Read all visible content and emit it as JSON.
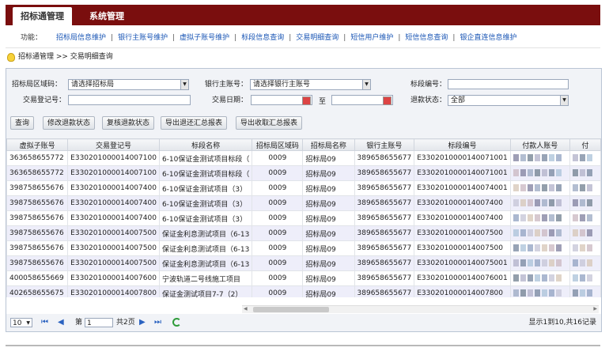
{
  "tabs": [
    "招标通管理",
    "系统管理"
  ],
  "funcbar": {
    "label": "功能：",
    "links": [
      "招标局信息维护",
      "银行主账号维护",
      "虚拟子账号维护",
      "标段信息查询",
      "交易明细查询",
      "短信用户维护",
      "短信信息查询",
      "银企直连信息维护"
    ]
  },
  "breadcrumb": "招标通管理 >> 交易明细查询",
  "form": {
    "area_label": "招标局区域码：",
    "area_value": "请选择招标局",
    "bank_label": "银行主账号：",
    "bank_value": "请选择银行主账号",
    "section_label": "标段编号：",
    "reg_label": "交易登记号：",
    "date_label": "交易日期：",
    "date_to": "至",
    "refund_label": "退款状态：",
    "refund_value": "全部"
  },
  "buttons": [
    "查询",
    "修改退款状态",
    "复核退款状态",
    "导出退还汇总报表",
    "导出收取汇总报表"
  ],
  "table": {
    "headers": [
      "虚拟子账号",
      "交易登记号",
      "标段名称",
      "招标局区域码",
      "招标局名称",
      "银行主账号",
      "标段编号",
      "付款人账号",
      "付"
    ],
    "rows": [
      [
        "363658655772",
        "E330201000014007100",
        "6-10保证金测试项目标段（",
        "0009",
        "招标局09",
        "389658655677",
        "E3302010000140071001"
      ],
      [
        "363658655772",
        "E330201000014007100",
        "6-10保证金测试项目标段（",
        "0009",
        "招标局09",
        "389658655677",
        "E3302010000140071001"
      ],
      [
        "398758655676",
        "E330201000014007400",
        "6-10保证金测试项目（3）",
        "0009",
        "招标局09",
        "389658655677",
        "E3302010000140074001"
      ],
      [
        "398758655676",
        "E330201000014007400",
        "6-10保证金测试项目（3）",
        "0009",
        "招标局09",
        "389658655677",
        "E330201000014007400"
      ],
      [
        "398758655676",
        "E330201000014007400",
        "6-10保证金测试项目（3）",
        "0009",
        "招标局09",
        "389658655677",
        "E330201000014007400"
      ],
      [
        "398758655676",
        "E330201000014007500",
        "保证金利息测试项目（6-13",
        "0009",
        "招标局09",
        "389658655677",
        "E330201000014007500"
      ],
      [
        "398758655676",
        "E330201000014007500",
        "保证金利息测试项目（6-13",
        "0009",
        "招标局09",
        "389658655677",
        "E330201000014007500"
      ],
      [
        "398758655676",
        "E330201000014007500",
        "保证金利息测试项目（6-13",
        "0009",
        "招标局09",
        "389658655677",
        "E3302010000140075001"
      ],
      [
        "400058655669",
        "E330201000014007600",
        "宁波轨道二号线施工项目",
        "0009",
        "招标局09",
        "389658655677",
        "E3302010000140076001"
      ],
      [
        "402658655675",
        "E330201000014007800",
        "保证金测试项目7-7（2）",
        "0009",
        "招标局09",
        "389658655677",
        "E330201000014007800"
      ]
    ]
  },
  "pager": {
    "page_size": "10",
    "page_label": "第",
    "page_value": "1",
    "total_pages": "共2页",
    "summary": "显示1到10,共16记录"
  },
  "colors": {
    "topbar": "#7a0e0e",
    "link": "#1a56b5",
    "alt_row": "#eeeefa"
  }
}
